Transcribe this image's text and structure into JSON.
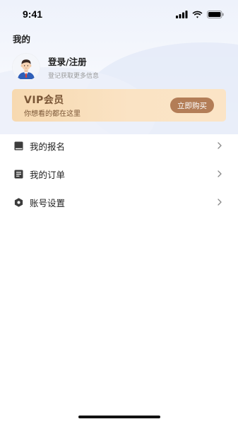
{
  "status_bar": {
    "time": "9:41",
    "icons": [
      "signal-icon",
      "wifi-icon",
      "battery-icon"
    ]
  },
  "page": {
    "title": "我的"
  },
  "user": {
    "name": "登录/注册",
    "subtitle": "登记获取更多信息",
    "avatar_icon": "person-avatar-icon"
  },
  "vip": {
    "title": "VIP会员",
    "subtitle": "你想看的都在这里",
    "button_label": "立即购买"
  },
  "menu": {
    "items": [
      {
        "label": "我的报名",
        "icon": "book-icon"
      },
      {
        "label": "我的订单",
        "icon": "document-icon"
      },
      {
        "label": "账号设置",
        "icon": "settings-hexagon-icon"
      }
    ]
  },
  "colors": {
    "vip_gradient_start": "#f7d9b0",
    "vip_gradient_end": "#fbe4c6",
    "vip_text": "#7a5636",
    "vip_button": "#b37d57",
    "hero_bg": "#eef2fb"
  }
}
